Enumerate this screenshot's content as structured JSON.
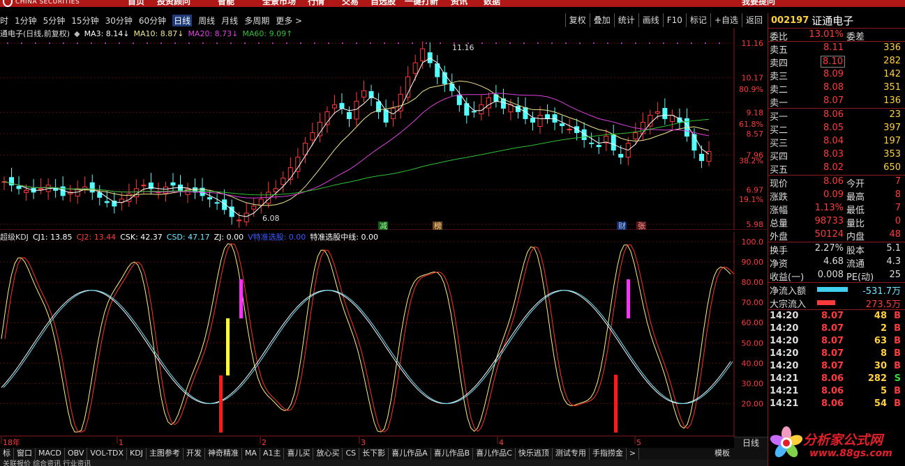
{
  "topbar": {
    "brand": "CHINA SECURITIES",
    "menus": [
      "首页",
      "投资顾问",
      "智能",
      "全景市场",
      "行情",
      "交易",
      "自选股",
      "一键打新",
      "资讯",
      "数据",
      "我要提问"
    ]
  },
  "toolbar": {
    "tabs": [
      "时",
      "1分钟",
      "5分钟",
      "15分钟",
      "30分钟",
      "60分钟",
      "日线",
      "周线",
      "月线",
      "多周期",
      "更多 >"
    ],
    "active_tab": "日线",
    "buttons": [
      "复权",
      "叠加",
      "统计",
      "画线",
      "F10",
      "标记",
      "+自选",
      "返回"
    ]
  },
  "main_legend": {
    "title": "通电子(日线,前复权)",
    "ma3": "MA3: 8.14↓",
    "ma10": "MA10: 8.87↓",
    "ma20": "MA20: 8.73↓",
    "ma60": "MA60: 9.09↑"
  },
  "price_axis": {
    "labels": [
      "11.16",
      "10.17",
      "80.9%",
      "9.18",
      "61.8%",
      "8.57",
      "7.96",
      "38.2%",
      "6.97",
      "19.1%",
      "5.98"
    ],
    "high_label": "11.16",
    "low_label": "6.08"
  },
  "event_markers": [
    "减",
    "榜",
    "财",
    "张"
  ],
  "indicator_legend": {
    "name": "超级KDJ",
    "cj1": "CJ1: 13.85",
    "cj2": "CJ2: 13.44",
    "csk": "CSK: 42.37",
    "csd": "CSD: 47.17",
    "zj": "ZJ: 0.00",
    "v": "V特准选股: 0.00",
    "mid": "特准选股中线: 0.00"
  },
  "indicator_axis": [
    "100.0",
    "90.00",
    "80.00",
    "70.00",
    "60.00",
    "50.00",
    "40.00",
    "30.00",
    "20.00"
  ],
  "date_axis": [
    "18年",
    "1",
    "2",
    "3",
    "4",
    "5"
  ],
  "bottom_tabs": [
    "标",
    "窗口",
    "MACD",
    "OBV",
    "VOL-TDX",
    "KDJ",
    "主图参考",
    "开发",
    "神奇精准",
    "MA",
    "A1主",
    "喜儿买",
    "放心买",
    "CS",
    "长下影",
    "喜儿作品A",
    "喜儿作品B",
    "喜儿作品C",
    "快乐逃顶",
    "测试专用",
    "手指捞金",
    ">"
  ],
  "bottom_status": "关联报价  综合资讯  行业资讯",
  "right_panel": {
    "code": "002197",
    "name": "证通电子",
    "weibi_label": "委比",
    "weibi": "13.01%",
    "weicha_label": "委差",
    "asks": [
      {
        "label": "卖五",
        "price": "8.11",
        "vol": "336"
      },
      {
        "label": "卖四",
        "price": "8.10",
        "vol": "282"
      },
      {
        "label": "卖三",
        "price": "8.09",
        "vol": "142"
      },
      {
        "label": "卖二",
        "price": "8.08",
        "vol": "351"
      },
      {
        "label": "卖一",
        "price": "8.07",
        "vol": "136"
      }
    ],
    "bids": [
      {
        "label": "买一",
        "price": "8.06",
        "vol": "23"
      },
      {
        "label": "买二",
        "price": "8.05",
        "vol": "397"
      },
      {
        "label": "买三",
        "price": "8.04",
        "vol": "197"
      },
      {
        "label": "买四",
        "price": "8.03",
        "vol": "353"
      },
      {
        "label": "买五",
        "price": "8.02",
        "vol": "650"
      }
    ],
    "stats": [
      {
        "l1": "现价",
        "v1": "8.06",
        "l2": "今开",
        "v2": "7"
      },
      {
        "l1": "涨跌",
        "v1": "0.09",
        "l2": "最高",
        "v2": "8"
      },
      {
        "l1": "涨幅",
        "v1": "1.13%",
        "l2": "最低",
        "v2": "7"
      },
      {
        "l1": "总量",
        "v1": "98733",
        "l2": "量比",
        "v2": "0"
      },
      {
        "l1": "外盘",
        "v1": "50124",
        "l2": "内盘",
        "v2": "48"
      }
    ],
    "fundamentals": [
      {
        "l1": "换手",
        "v1": "2.27%",
        "l2": "股本",
        "v2": "5.1"
      },
      {
        "l1": "净资",
        "v1": "4.68",
        "l2": "流通",
        "v2": "4.3"
      },
      {
        "l1": "收益(一)",
        "v1": "0.008",
        "l2": "PE(动)",
        "v2": "25"
      }
    ],
    "flows": [
      {
        "label": "净流入额",
        "value": "-531.7万",
        "color": "#3fd0f0"
      },
      {
        "label": "大宗流入",
        "value": "273.5万",
        "color": "#ff3a3a"
      }
    ],
    "ticks": [
      {
        "time": "14:20",
        "price": "8.07",
        "vol": "48",
        "side": "B"
      },
      {
        "time": "14:20",
        "price": "8.07",
        "vol": "2",
        "side": "B"
      },
      {
        "time": "14:20",
        "price": "8.07",
        "vol": "63",
        "side": "B"
      },
      {
        "time": "14:20",
        "price": "8.07",
        "vol": "8",
        "side": "B"
      },
      {
        "time": "14:20",
        "price": "8.07",
        "vol": "30",
        "side": "B"
      },
      {
        "time": "14:21",
        "price": "8.06",
        "vol": "282",
        "side": "S"
      },
      {
        "time": "14:21",
        "price": "8.06",
        "vol": "5",
        "side": "B"
      },
      {
        "time": "14:21",
        "price": "8.06",
        "vol": "54",
        "side": "B"
      }
    ],
    "day_tab": "日线",
    "model_tab": "模板"
  },
  "watermark": {
    "text": "分析家公式网",
    "url": "www.88gs.com"
  },
  "chart_data": {
    "type": "candlestick",
    "y_range": [
      5.98,
      11.16
    ],
    "high": 11.16,
    "low": 6.08,
    "last_close": 8.06,
    "approx_closes": [
      7.2,
      7.1,
      7.0,
      6.95,
      6.9,
      7.0,
      7.1,
      6.95,
      6.8,
      6.9,
      7.0,
      7.05,
      6.9,
      6.75,
      6.6,
      6.5,
      6.7,
      6.85,
      7.0,
      7.1,
      7.0,
      6.9,
      7.05,
      7.1,
      6.95,
      7.0,
      6.9,
      6.8,
      6.7,
      6.6,
      6.4,
      6.2,
      6.1,
      6.3,
      6.5,
      6.7,
      6.9,
      7.0,
      7.3,
      7.6,
      7.9,
      8.3,
      8.6,
      8.9,
      9.2,
      9.4,
      9.3,
      9.0,
      9.5,
      9.8,
      9.6,
      9.2,
      8.9,
      9.3,
      9.7,
      10.2,
      10.6,
      11.0,
      10.6,
      10.2,
      10.0,
      9.8,
      9.4,
      9.1,
      9.2,
      9.4,
      9.6,
      9.5,
      9.3,
      9.4,
      9.2,
      9.0,
      8.9,
      9.1,
      9.0,
      8.9,
      8.8,
      8.7,
      8.6,
      8.4,
      8.3,
      8.2,
      8.5,
      8.1,
      7.9,
      8.3,
      8.6,
      8.9,
      9.1,
      9.2,
      9.0,
      9.1,
      8.9,
      8.5,
      8.1,
      7.8,
      8.06
    ],
    "series": [
      {
        "name": "MA3",
        "color": "#ffffff"
      },
      {
        "name": "MA10",
        "color": "#f0e68c"
      },
      {
        "name": "MA20",
        "color": "#e040e0"
      },
      {
        "name": "MA60",
        "color": "#30c030"
      }
    ]
  }
}
